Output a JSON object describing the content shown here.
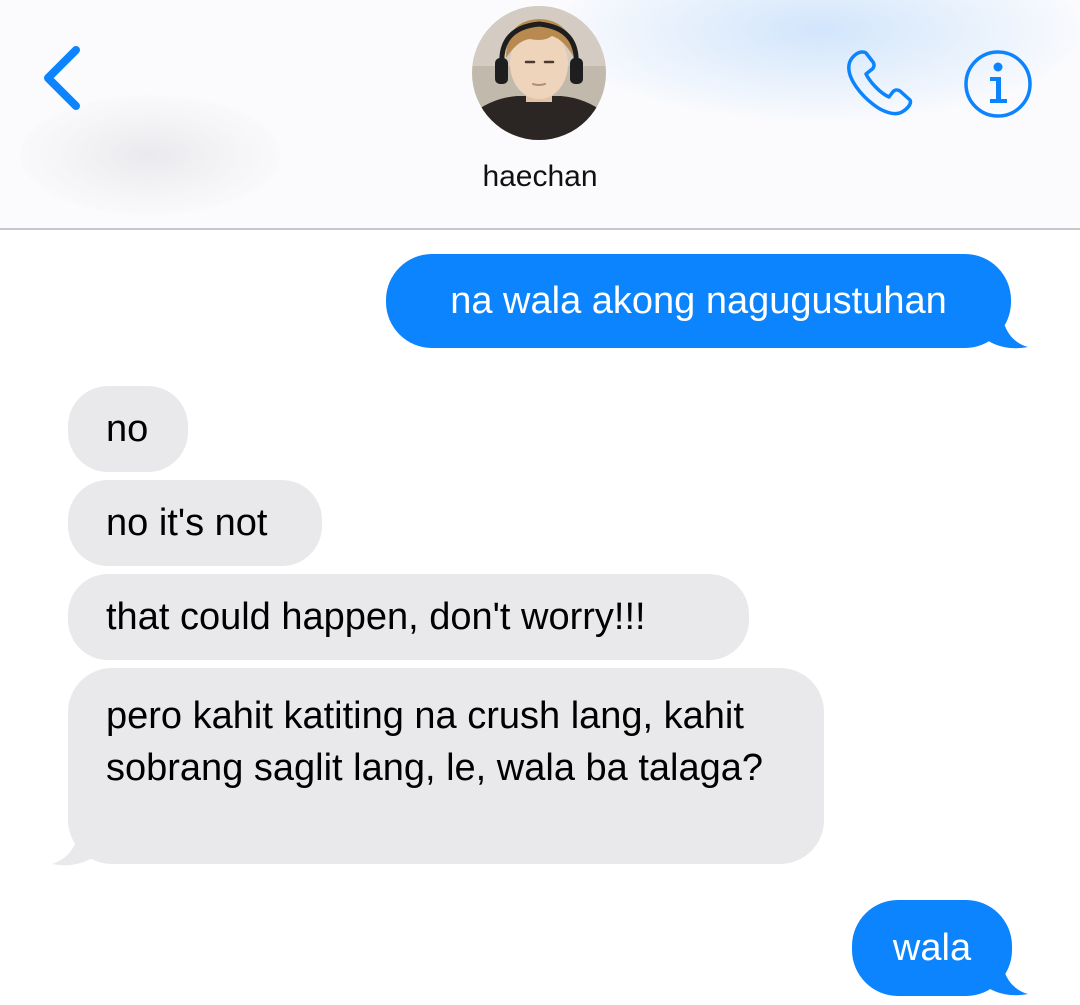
{
  "header": {
    "contact_name": "haechan",
    "icons": {
      "back": "chevron-left-icon",
      "call": "phone-icon",
      "info": "info-icon"
    },
    "accent_color": "#0b84fe"
  },
  "messages": [
    {
      "direction": "sent",
      "text": "na wala akong nagugustuhan"
    },
    {
      "direction": "received",
      "text": "no"
    },
    {
      "direction": "received",
      "text": "no it's not"
    },
    {
      "direction": "received",
      "text": "that could happen, don't worry!!!"
    },
    {
      "direction": "received",
      "text": "pero kahit katiting na crush lang, kahit sobrang saglit lang, le, wala ba talaga?"
    },
    {
      "direction": "sent",
      "text": "wala"
    }
  ],
  "colors": {
    "sent_bubble": "#0b84fe",
    "received_bubble": "#e9e9eb"
  }
}
